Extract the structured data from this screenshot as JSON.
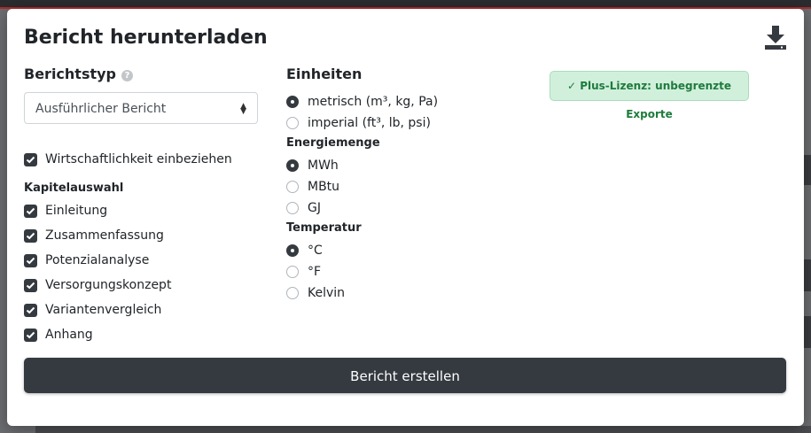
{
  "modal": {
    "title": "Bericht herunterladen",
    "download_icon": "download-icon"
  },
  "report_type": {
    "heading": "Berichtstyp",
    "help_icon": "question-circle-icon",
    "help_glyph": "?",
    "selected": "Ausführlicher Bericht"
  },
  "economy": {
    "label": "Wirtschaftlichkeit einbeziehen",
    "checked": true
  },
  "chapters": {
    "heading": "Kapitelauswahl",
    "items": [
      {
        "label": "Einleitung",
        "checked": true
      },
      {
        "label": "Zusammenfassung",
        "checked": true
      },
      {
        "label": "Potenzialanalyse",
        "checked": true
      },
      {
        "label": "Versorgungskonzept",
        "checked": true
      },
      {
        "label": "Variantenvergleich",
        "checked": true
      },
      {
        "label": "Anhang",
        "checked": true
      }
    ]
  },
  "units": {
    "heading": "Einheiten",
    "options": [
      {
        "label": "metrisch (m³, kg, Pa)",
        "selected": true
      },
      {
        "label": "imperial (ft³, lb, psi)",
        "selected": false
      }
    ]
  },
  "energy": {
    "heading": "Energiemenge",
    "options": [
      {
        "label": "MWh",
        "selected": true
      },
      {
        "label": "MBtu",
        "selected": false
      },
      {
        "label": "GJ",
        "selected": false
      }
    ]
  },
  "temperature": {
    "heading": "Temperatur",
    "options": [
      {
        "label": "°C",
        "selected": true
      },
      {
        "label": "°F",
        "selected": false
      },
      {
        "label": "Kelvin",
        "selected": false
      }
    ]
  },
  "license_badge": {
    "text": "✓ Plus-Lizenz: unbegrenzte Exporte",
    "color": "#1e7b3c"
  },
  "create_button": {
    "label": "Bericht erstellen"
  },
  "colors": {
    "primary": "#343a40",
    "badge_bg": "#d1f0dc",
    "overlay": "#6b6d70"
  }
}
